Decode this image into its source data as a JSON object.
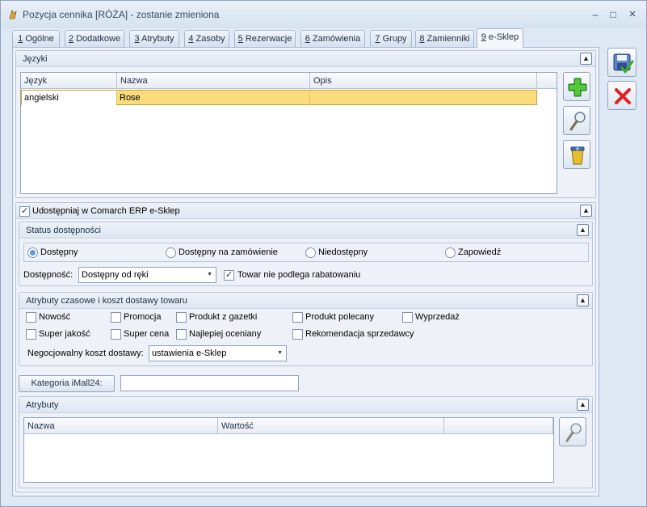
{
  "window": {
    "title": "Pozycja cennika [RÓŻA] - zostanie zmieniona",
    "controls": {
      "minimize": "–",
      "maximize": "□",
      "close": "×"
    }
  },
  "tabs": [
    {
      "num": "1",
      "label": " Ogólne"
    },
    {
      "num": "2",
      "label": " Dodatkowe"
    },
    {
      "num": "3",
      "label": " Atrybuty"
    },
    {
      "num": "4",
      "label": " Zasoby"
    },
    {
      "num": "5",
      "label": " Rezerwacje"
    },
    {
      "num": "6",
      "label": " Zamówienia"
    },
    {
      "num": "7",
      "label": " Grupy"
    },
    {
      "num": "8",
      "label": " Zamienniki"
    },
    {
      "num": "9",
      "label": " e-Sklep"
    }
  ],
  "active_tab_index": 8,
  "languages": {
    "title": "Języki",
    "columns": [
      "Język",
      "Nazwa",
      "Opis"
    ],
    "rows": [
      {
        "jezyk": "angielski",
        "nazwa": "Rose",
        "opis": ""
      }
    ]
  },
  "share": {
    "label": "Udostępniaj w Comarch ERP e-Sklep",
    "checked": true
  },
  "status": {
    "title": "Status dostępności",
    "options": [
      "Dostępny",
      "Dostępny na zamówienie",
      "Niedostępny",
      "Zapowiedź"
    ],
    "selected_index": 0,
    "availability_label": "Dostępność:",
    "availability_value": "Dostępny od ręki",
    "discount_label": "Towar nie podlega rabatowaniu",
    "discount_checked": true
  },
  "attributes_time": {
    "title": "Atrybuty czasowe  i koszt dostawy towaru",
    "checkboxes": [
      "Nowość",
      "Promocja",
      "Produkt z gazetki",
      "Produkt polecany",
      "Wyprzedaż",
      "Super jakość",
      "Super cena",
      "Najlepiej oceniany",
      "Rekomendacja sprzedawcy"
    ],
    "delivery_label": "Negocjowalny koszt dostawy:",
    "delivery_value": "ustawienia e-Sklep"
  },
  "imall": {
    "button_label": "Kategoria iMall24:",
    "value": ""
  },
  "attributes": {
    "title": "Atrybuty",
    "columns": [
      "Nazwa",
      "Wartość",
      ""
    ]
  },
  "colors": {
    "selected_row": "#fadc7c",
    "selected_cell": "#ffffff",
    "accent": "#5d9bd9",
    "add_icon": "#3aae2a",
    "cancel_icon": "#e02020"
  },
  "icons": {
    "save": "save-icon",
    "cancel": "cancel-icon",
    "add": "plus-icon",
    "edit": "magnifier-icon",
    "delete": "trash-icon",
    "collapse": "collapse-icon"
  }
}
